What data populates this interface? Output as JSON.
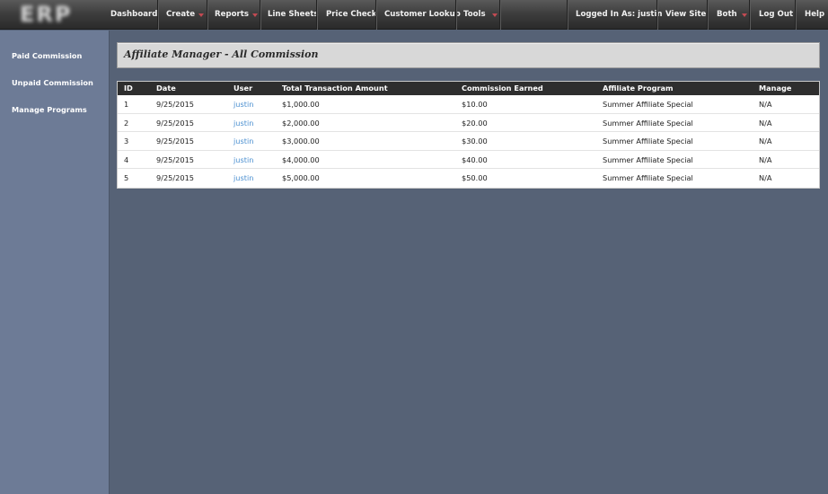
{
  "topbar": {
    "logo_text": "ERP",
    "nav": [
      {
        "label": "Dashboard"
      },
      {
        "label": "Create"
      },
      {
        "label": "Reports"
      },
      {
        "label": "Line Sheets"
      },
      {
        "label": "Price Check"
      },
      {
        "label": "Customer Lookup"
      },
      {
        "label": "Tools"
      }
    ],
    "right": {
      "logged_in": "Logged In As: justin",
      "view_site": "View Site",
      "both": "Both",
      "logout": "Log Out",
      "help": "Help"
    },
    "caret_color": "#c24a52"
  },
  "sidebar": {
    "items": [
      {
        "label": "Paid Commission"
      },
      {
        "label": "Unpaid Commission"
      },
      {
        "label": "Manage Programs"
      }
    ]
  },
  "page": {
    "title": "Affiliate Manager - All Commission"
  },
  "table": {
    "headers": [
      "ID",
      "Date",
      "User",
      "Total Transaction Amount",
      "Commission Earned",
      "Affiliate Program",
      "Manage"
    ],
    "rows": [
      {
        "id": "1",
        "date": "9/25/2015",
        "user": "justin",
        "total": "$1,000.00",
        "commission": "$10.00",
        "program": "Summer Affiliate Special",
        "manage": "N/A"
      },
      {
        "id": "2",
        "date": "9/25/2015",
        "user": "justin",
        "total": "$2,000.00",
        "commission": "$20.00",
        "program": "Summer Affiliate Special",
        "manage": "N/A"
      },
      {
        "id": "3",
        "date": "9/25/2015",
        "user": "justin",
        "total": "$3,000.00",
        "commission": "$30.00",
        "program": "Summer Affiliate Special",
        "manage": "N/A"
      },
      {
        "id": "4",
        "date": "9/25/2015",
        "user": "justin",
        "total": "$4,000.00",
        "commission": "$40.00",
        "program": "Summer Affiliate Special",
        "manage": "N/A"
      },
      {
        "id": "5",
        "date": "9/25/2015",
        "user": "justin",
        "total": "$5,000.00",
        "commission": "$50.00",
        "program": "Summer Affiliate Special",
        "manage": "N/A"
      }
    ]
  },
  "colors": {
    "background": "#566276",
    "sidebar": "#6d7b96",
    "link": "#4a8fd0",
    "table_header": "#2e2e2e"
  }
}
